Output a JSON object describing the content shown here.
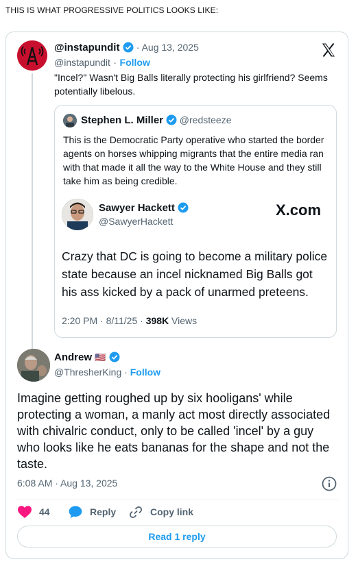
{
  "page": {
    "heading": "THIS IS WHAT PROGRESSIVE POLITICS LOOKS LIKE:"
  },
  "post": {
    "name": "@instapundit",
    "date": "· Aug 13, 2025",
    "handle": "@instapundit",
    "separator": "·",
    "follow": "Follow",
    "text": "\"Incel?\"  Wasn't Big Balls literally protecting his girlfriend? Seems potentially libelous."
  },
  "quote": {
    "name": "Stephen L. Miller",
    "handle": "@redsteeze",
    "text": "This is the Democratic Party operative who started the border agents on horses whipping migrants that the entire media ran with that made it all the way to the White House and they still take him as being credible.",
    "embed": {
      "name": "Sawyer Hackett",
      "handle": "@SawyerHackett",
      "brand": "X.com",
      "text": "Crazy that DC is going to become a military police state because an incel nicknamed Big Balls got his ass kicked by a pack of unarmed preteens.",
      "time": "2:20 PM · 8/11/25 · ",
      "views_count": "398K",
      "views_label": " Views"
    }
  },
  "reply": {
    "name": "Andrew",
    "flag": "🇺🇸",
    "handle": "@ThresherKing",
    "separator": "·",
    "follow": "Follow",
    "text": "Imagine getting roughed up by six  hooligans' while protecting a woman, a manly act most directly associated with chivalric conduct, only to be called 'incel' by a guy who looks like he eats bananas for the shape and not the taste.",
    "time": "6:08 AM · Aug 13, 2025"
  },
  "actions": {
    "like_count": "44",
    "reply_label": "Reply",
    "copy_label": "Copy link",
    "read_replies": "Read 1 reply"
  },
  "colors": {
    "accent": "#1d9bf0",
    "like": "#f91880",
    "text": "#0f1419",
    "muted": "#536471",
    "border": "#cfd9de"
  },
  "icons": [
    "verified-badge-icon",
    "x-logo-icon",
    "info-icon",
    "heart-icon",
    "reply-bubble-icon",
    "link-icon"
  ]
}
